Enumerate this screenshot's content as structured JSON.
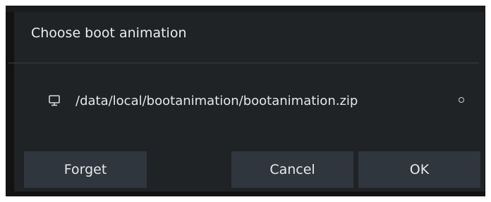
{
  "dialog": {
    "title": "Choose boot animation",
    "options": [
      {
        "icon": "monitor-icon",
        "label": "/data/local/bootanimation/bootanimation.zip",
        "selected": false
      }
    ],
    "buttons": {
      "forget": "Forget",
      "cancel": "Cancel",
      "ok": "OK"
    }
  },
  "colors": {
    "background": "#1f2326",
    "button": "#2f363d",
    "text": "#e8e8e8"
  }
}
